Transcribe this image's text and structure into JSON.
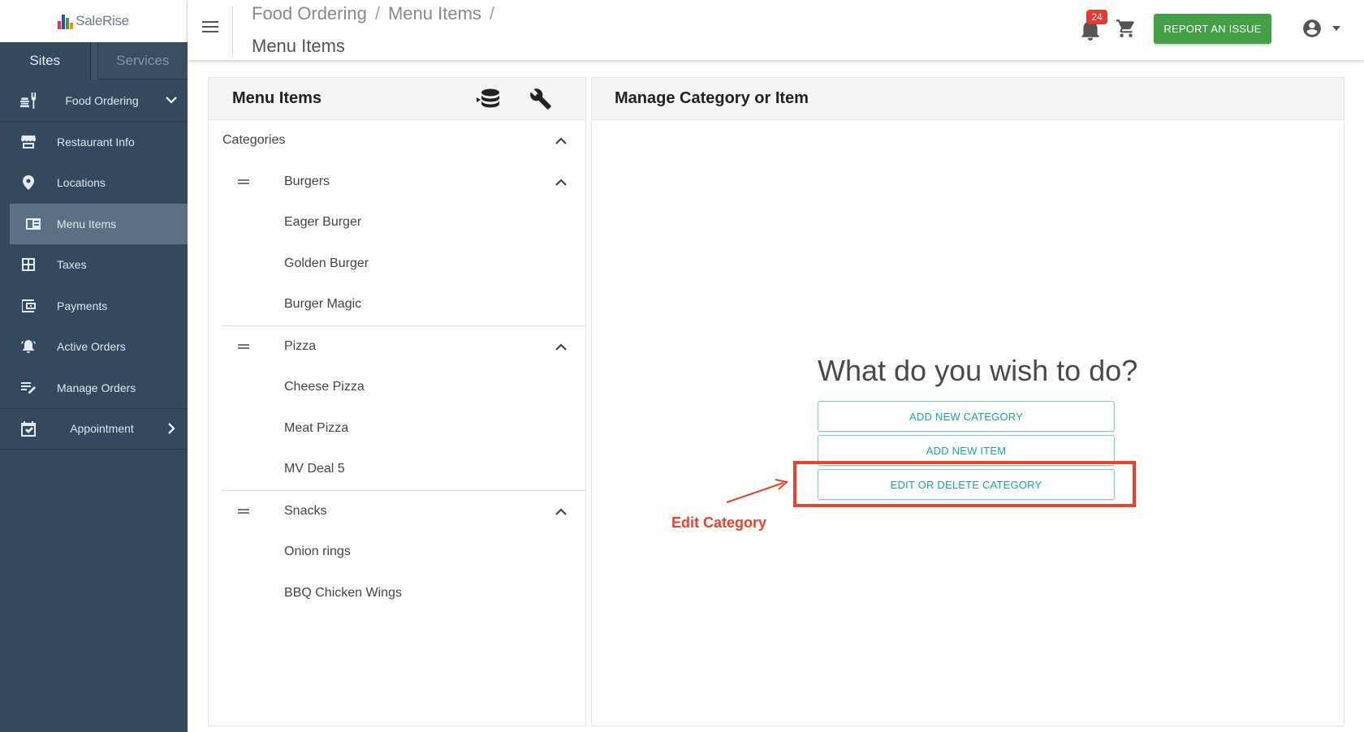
{
  "brand": {
    "name": "SaleRise",
    "colors": [
      "#e53935",
      "#3949ab",
      "#43a047",
      "#fb8c00"
    ]
  },
  "sidebar": {
    "tabs": [
      {
        "label": "Sites"
      },
      {
        "label": "Services"
      }
    ],
    "items": [
      {
        "label": "Food Ordering",
        "icon": "food-icon"
      },
      {
        "label": "Restaurant Info",
        "icon": "storefront-icon"
      },
      {
        "label": "Locations",
        "icon": "location-pin-icon"
      },
      {
        "label": "Menu Items",
        "icon": "menu-book-icon"
      },
      {
        "label": "Taxes",
        "icon": "calculator-icon"
      },
      {
        "label": "Payments",
        "icon": "wallet-icon"
      },
      {
        "label": "Active Orders",
        "icon": "bell-ring-icon"
      },
      {
        "label": "Manage Orders",
        "icon": "edit-list-icon"
      },
      {
        "label": "Appointment",
        "icon": "calendar-check-icon"
      }
    ]
  },
  "header": {
    "breadcrumb": [
      "Food Ordering",
      "Menu Items"
    ],
    "separator": "/",
    "title": "Menu Items",
    "notifications_count": "24",
    "report_label": "REPORT AN ISSUE"
  },
  "left_panel": {
    "title": "Menu Items",
    "root_label": "Categories",
    "categories": [
      {
        "name": "Burgers",
        "items": [
          "Eager Burger",
          "Golden Burger",
          "Burger Magic"
        ]
      },
      {
        "name": "Pizza",
        "items": [
          "Cheese Pizza",
          "Meat Pizza",
          "MV Deal 5"
        ]
      },
      {
        "name": "Snacks",
        "items": [
          "Onion rings",
          "BBQ Chicken Wings"
        ]
      }
    ]
  },
  "right_panel": {
    "title": "Manage Category or Item",
    "prompt": "What do you wish to do?",
    "actions": [
      "ADD NEW CATEGORY",
      "ADD NEW ITEM",
      "EDIT OR DELETE CATEGORY"
    ],
    "annotation": {
      "text": "Edit Category",
      "color": "#e8432b"
    }
  }
}
